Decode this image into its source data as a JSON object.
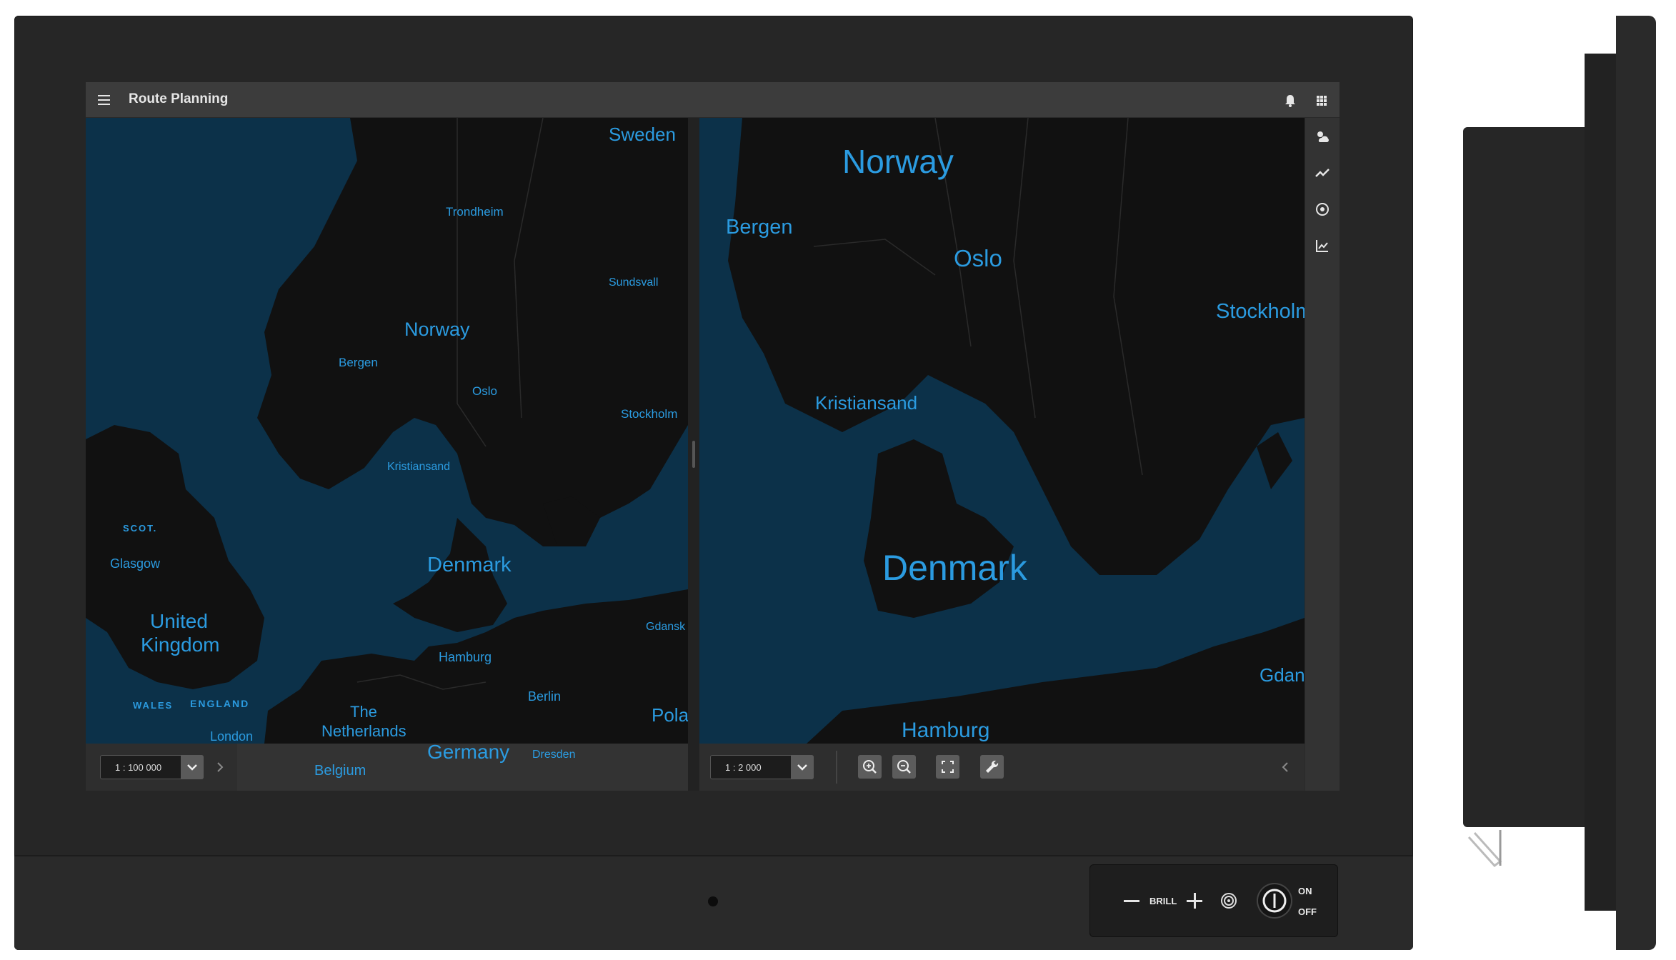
{
  "app": {
    "title": "Route Planning"
  },
  "topbar": {
    "icons": [
      "menu-icon",
      "bell-icon",
      "apps-grid-icon"
    ]
  },
  "rail": {
    "icons": [
      "weather-icon",
      "route-trend-icon",
      "target-icon",
      "chart-icon"
    ]
  },
  "left_map": {
    "labels": {
      "sweden": "Sweden",
      "trondheim": "Trondheim",
      "sundsvall": "Sundsvall",
      "norway": "Norway",
      "bergen": "Bergen",
      "oslo": "Oslo",
      "stockholm": "Stockholm",
      "kristiansand": "Kristiansand",
      "scot": "SCOT.",
      "glasgow": "Glasgow",
      "united": "United",
      "kingdom": "Kingdom",
      "denmark": "Denmark",
      "gdansk": "Gdansk",
      "hamburg": "Hamburg",
      "berlin": "Berlin",
      "the": "The",
      "netherlands": "Netherlands",
      "wales": "WALES",
      "england": "ENGLAND",
      "london": "London",
      "pola": "Pola",
      "germany": "Germany",
      "belgium": "Belgium",
      "dresden": "Dresden"
    },
    "scale": "1 : 100 000"
  },
  "right_map": {
    "labels": {
      "norway": "Norway",
      "bergen": "Bergen",
      "oslo": "Oslo",
      "stockholm": "Stockholm",
      "kristiansand": "Kristiansand",
      "denmark": "Denmark",
      "hamburg": "Hamburg",
      "gdansk": "Gdan"
    },
    "scale": "1 : 2 000",
    "tools": [
      "zoom-in-icon",
      "zoom-out-icon",
      "fit-screen-icon",
      "wrench-icon"
    ]
  },
  "hardware": {
    "brill": "BRILL",
    "on": "ON",
    "off": "OFF"
  },
  "colors": {
    "sea": "#0c3149",
    "land": "#111111",
    "label": "#2b9be0",
    "bezel": "#262626"
  }
}
